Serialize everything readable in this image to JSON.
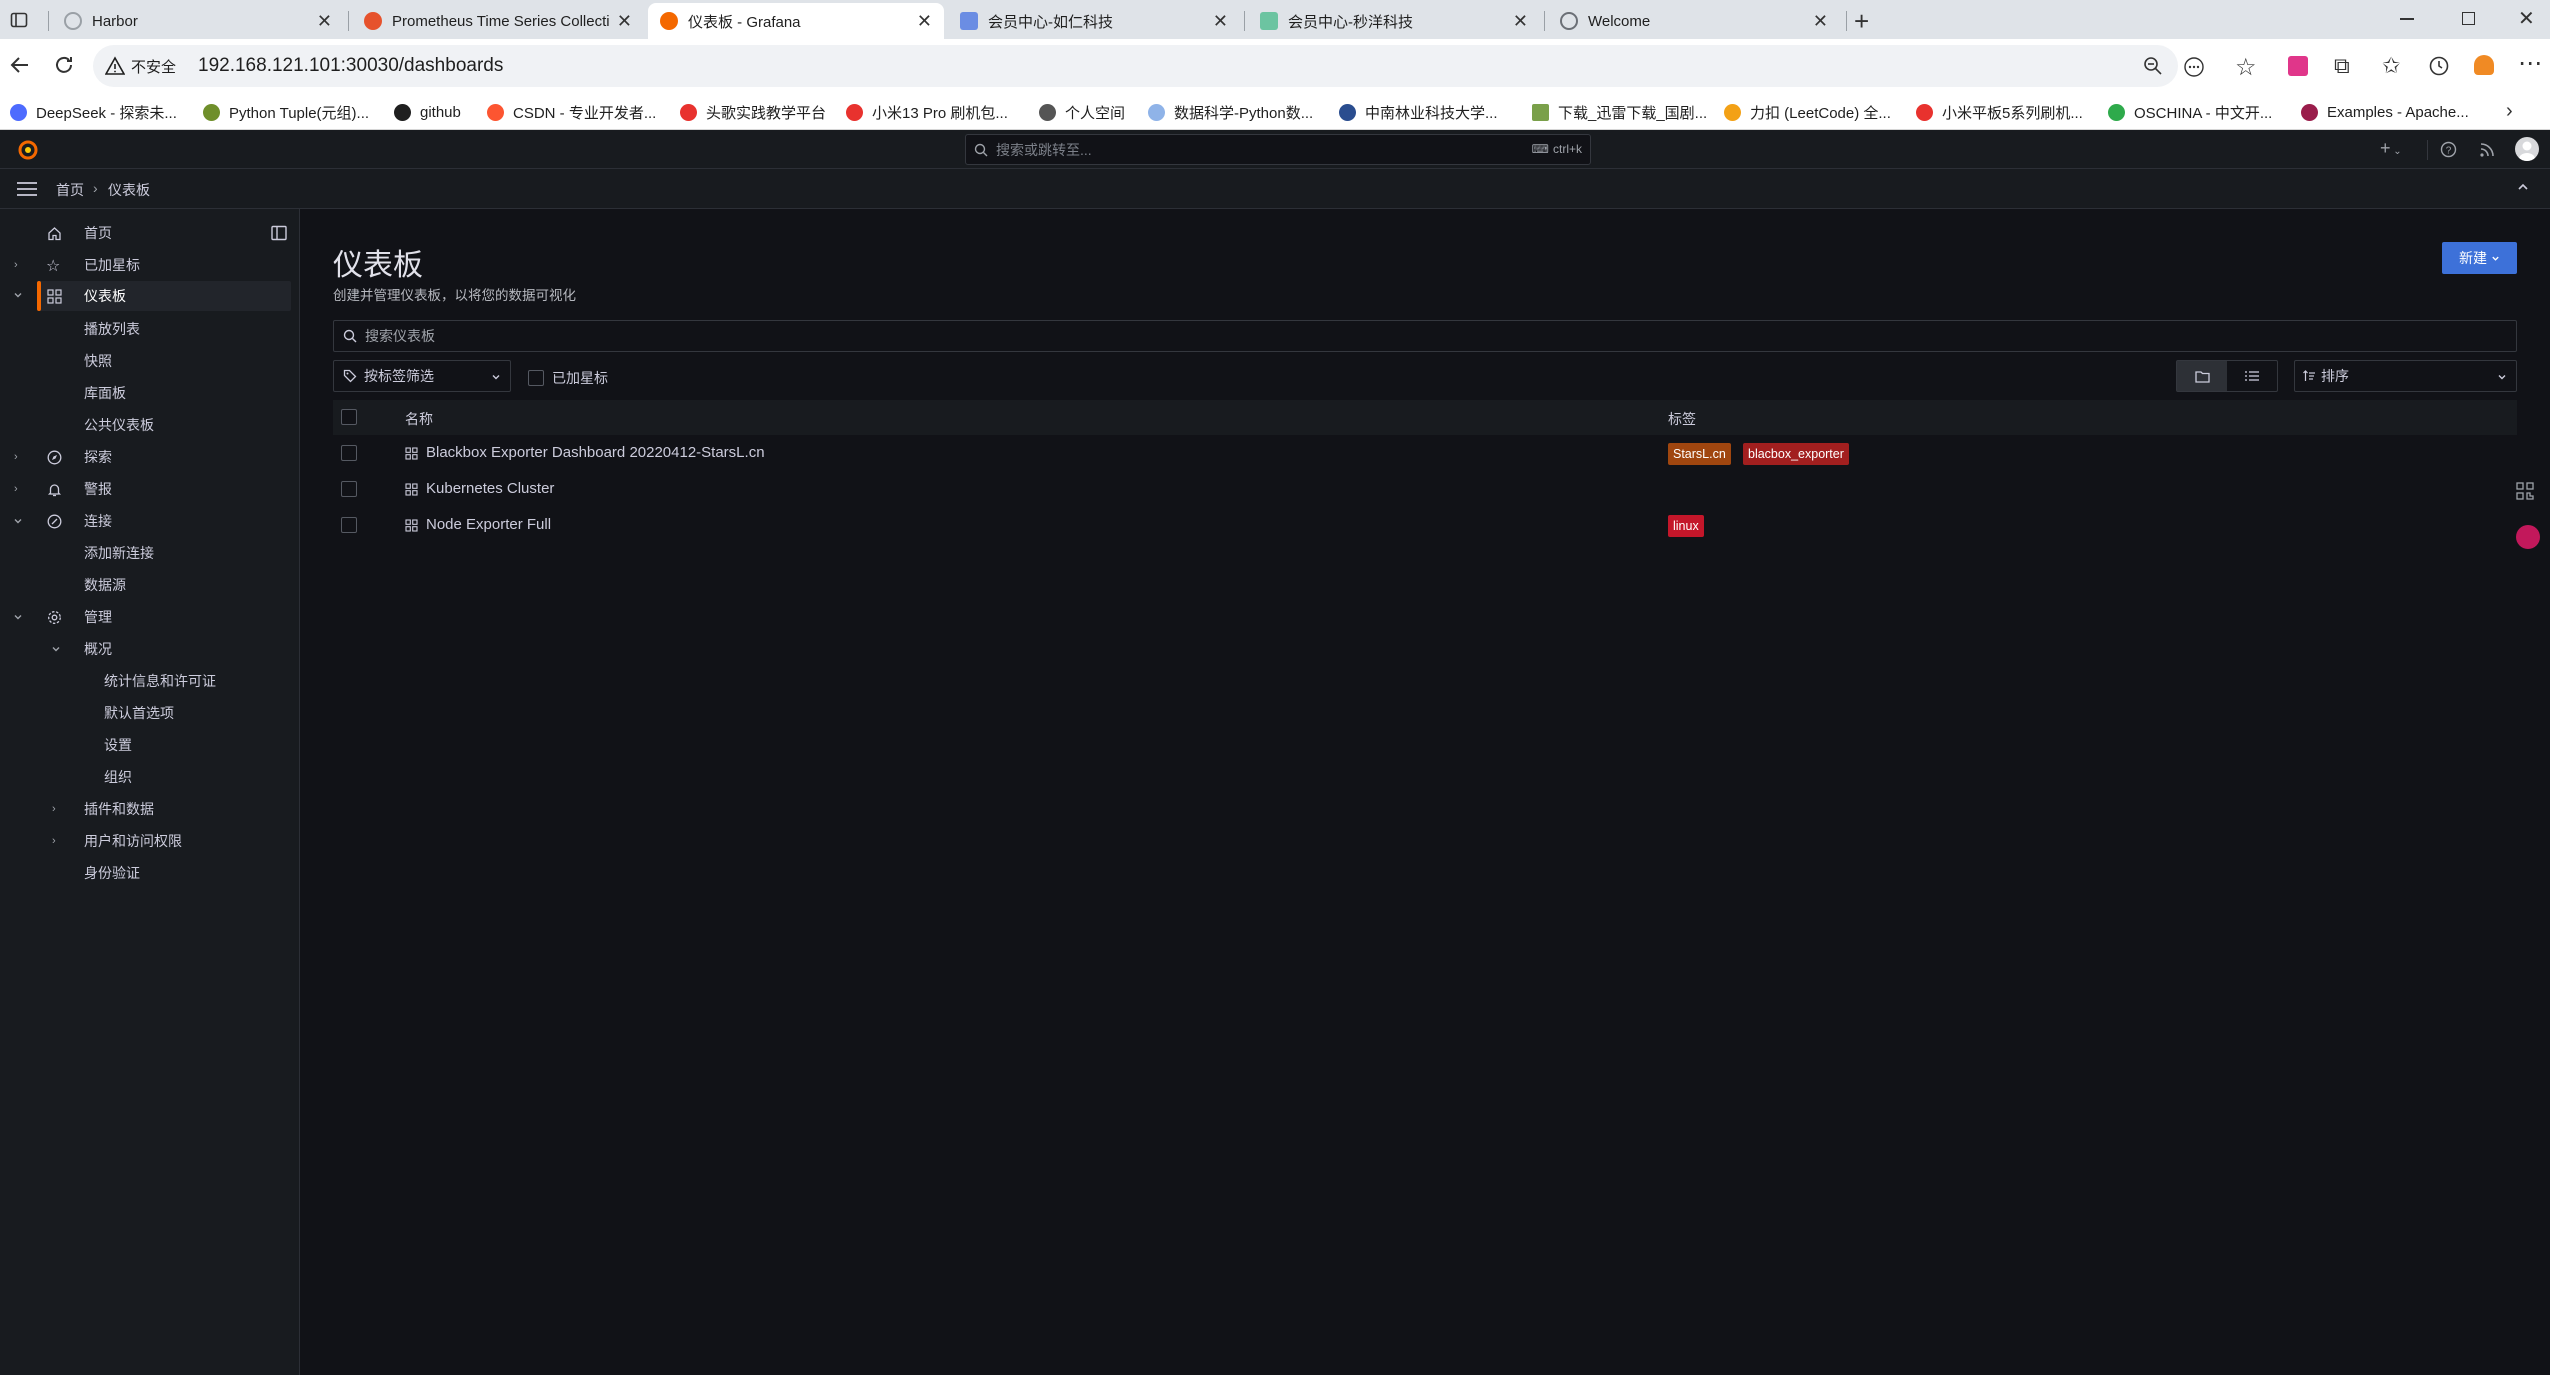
{
  "browser": {
    "tabs": [
      {
        "title": "Harbor",
        "active": false,
        "color": "#b0b4ba"
      },
      {
        "title": "Prometheus Time Series Collection",
        "active": false,
        "color": "#e6522c"
      },
      {
        "title": "仪表板 - Grafana",
        "active": true,
        "color": "#f46800"
      },
      {
        "title": "会员中心-如仁科技",
        "active": false,
        "color": "#6b8de3"
      },
      {
        "title": "会员中心-秒洋科技",
        "active": false,
        "color": "#6cc4a1"
      },
      {
        "title": "Welcome",
        "active": false,
        "color": "#6b6f76"
      }
    ],
    "address": {
      "security_label": "不安全",
      "url": "192.168.121.101:30030/dashboards"
    },
    "bookmarks": [
      {
        "label": "DeepSeek - 探索未...",
        "color": "#4d6bfe"
      },
      {
        "label": "Python Tuple(元组)...",
        "color": "#6f8f2b"
      },
      {
        "label": "github",
        "color": "#1f1f1f"
      },
      {
        "label": "CSDN - 专业开发者...",
        "color": "#fc5531"
      },
      {
        "label": "头歌实践教学平台",
        "color": "#e8322e"
      },
      {
        "label": "小米13 Pro 刷机包...",
        "color": "#e8322e"
      },
      {
        "label": "个人空间",
        "color": "#555555"
      },
      {
        "label": "数据科学-Python数...",
        "color": "#8fb3e8"
      },
      {
        "label": "中南林业科技大学...",
        "color": "#2a4d8f"
      },
      {
        "label": "下载_迅雷下载_国剧...",
        "color": "#7aa04a"
      },
      {
        "label": "力扣 (LeetCode) 全...",
        "color": "#f3a116"
      },
      {
        "label": "小米平板5系列刷机...",
        "color": "#e8322e"
      },
      {
        "label": "OSCHINA - 中文开...",
        "color": "#2eaa4b"
      },
      {
        "label": "Examples - Apache...",
        "color": "#9a1d4b"
      }
    ]
  },
  "grafana": {
    "search_placeholder": "搜索或跳转至...",
    "search_shortcut": "ctrl+k",
    "breadcrumb": [
      "首页",
      "仪表板"
    ],
    "sidebar": {
      "items": [
        {
          "label": "首页",
          "level": 0,
          "icon": "home-icon"
        },
        {
          "label": "已加星标",
          "level": 0,
          "icon": "star-icon",
          "chevron": "right"
        },
        {
          "label": "仪表板",
          "level": 0,
          "icon": "apps-icon",
          "chevron": "down",
          "active": true
        },
        {
          "label": "播放列表",
          "level": 1
        },
        {
          "label": "快照",
          "level": 1
        },
        {
          "label": "库面板",
          "level": 1
        },
        {
          "label": "公共仪表板",
          "level": 1
        },
        {
          "label": "探索",
          "level": 0,
          "icon": "compass-icon",
          "chevron": "right"
        },
        {
          "label": "警报",
          "level": 0,
          "icon": "bell-icon",
          "chevron": "right"
        },
        {
          "label": "连接",
          "level": 0,
          "icon": "link-icon",
          "chevron": "down"
        },
        {
          "label": "添加新连接",
          "level": 1
        },
        {
          "label": "数据源",
          "level": 1
        },
        {
          "label": "管理",
          "level": 0,
          "icon": "gear-icon",
          "chevron": "down"
        },
        {
          "label": "概况",
          "level": 1,
          "chevron": "down"
        },
        {
          "label": "统计信息和许可证",
          "level": 2
        },
        {
          "label": "默认首选项",
          "level": 2
        },
        {
          "label": "设置",
          "level": 2
        },
        {
          "label": "组织",
          "level": 2
        },
        {
          "label": "插件和数据",
          "level": 1,
          "chevron": "right"
        },
        {
          "label": "用户和访问权限",
          "level": 1,
          "chevron": "right"
        },
        {
          "label": "身份验证",
          "level": 1
        }
      ]
    },
    "page": {
      "title": "仪表板",
      "subtitle": "创建并管理仪表板，以将您的数据可视化",
      "new_button": "新建",
      "search_placeholder": "搜索仪表板",
      "tag_filter_label": "按标签筛选",
      "starred_label": "已加星标",
      "sort_label": "排序",
      "columns": {
        "name": "名称",
        "tags": "标签"
      },
      "rows": [
        {
          "name": "Blackbox Exporter Dashboard 20220412-StarsL.cn",
          "tags": [
            {
              "label": "StarsL.cn",
              "color": "#a0460f"
            },
            {
              "label": "blacbox_exporter",
              "color": "#a21f1f"
            }
          ]
        },
        {
          "name": "Kubernetes Cluster",
          "tags": []
        },
        {
          "name": "Node Exporter Full",
          "tags": [
            {
              "label": "linux",
              "color": "#c4162a"
            }
          ]
        }
      ]
    }
  }
}
